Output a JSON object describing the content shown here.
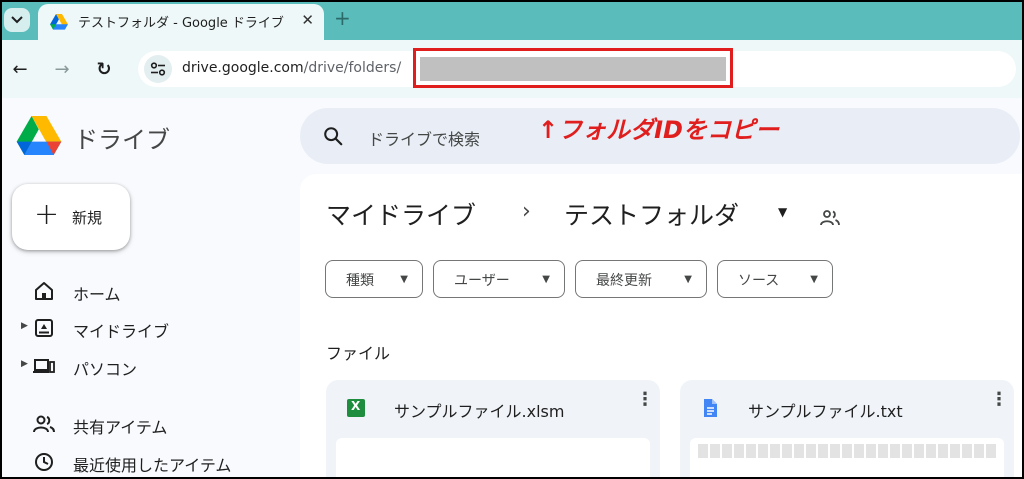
{
  "browser": {
    "tab": {
      "title": "テストフォルダ - Google ドライブ",
      "close": "✕"
    },
    "new_tab": "+",
    "back": "←",
    "forward": "→",
    "reload": "↻",
    "url": {
      "host": "drive.google.com",
      "path": "/drive/folders/"
    }
  },
  "annotation": "↑フォルダIDをコピー",
  "drive": {
    "app_name": "ドライブ",
    "search_placeholder": "ドライブで検索",
    "new_button": {
      "icon": "+",
      "label": "新規"
    },
    "nav": [
      {
        "label": "ホーム",
        "icon": "home-icon",
        "expandable": false
      },
      {
        "label": "マイドライブ",
        "icon": "my-drive-icon",
        "expandable": true
      },
      {
        "label": "パソコン",
        "icon": "computers-icon",
        "expandable": true
      },
      {
        "label": "共有アイテム",
        "icon": "shared-icon",
        "expandable": false
      },
      {
        "label": "最近使用したアイテム",
        "icon": "recent-icon",
        "expandable": false
      }
    ],
    "breadcrumb": {
      "root": "マイドライブ",
      "separator": "›",
      "current": "テストフォルダ"
    },
    "filters": [
      {
        "label": "種類"
      },
      {
        "label": "ユーザー"
      },
      {
        "label": "最終更新"
      },
      {
        "label": "ソース"
      }
    ],
    "section_title": "ファイル",
    "files": [
      {
        "name": "サンプルファイル.xlsm",
        "icon": "excel-icon",
        "icon_letter": "X",
        "icon_color": "#1e8e3e"
      },
      {
        "name": "サンプルファイル.txt",
        "icon": "docs-icon",
        "icon_color": "#4285f4"
      }
    ]
  },
  "colors": {
    "tabbar": "#5bbcbc",
    "toolbar": "#eef8f8",
    "highlight_red": "#e01e1e",
    "search_bg": "#e9eef6",
    "app_bg": "#f8fafd"
  }
}
